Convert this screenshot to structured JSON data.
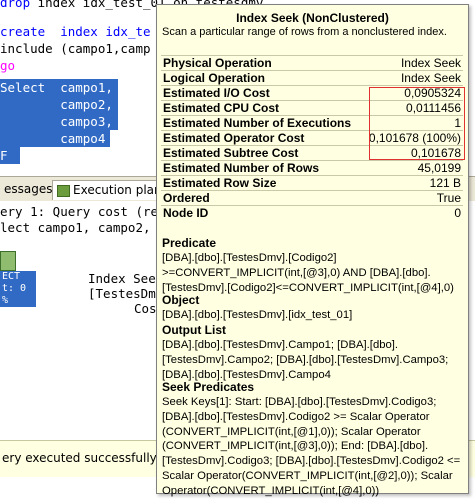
{
  "editor": {
    "lines": [
      {
        "kw": "drop",
        "rest": " index idx_test_01 on testesdmv"
      },
      {
        "kw": "create",
        "rest": "  index idx_te"
      },
      {
        "kw": "",
        "rest": "include (campo1,camp"
      },
      {
        "kw": "go",
        "rest": ""
      },
      {
        "kw": "Select",
        "rest": "  campo1,"
      },
      {
        "kw": "",
        "rest": "        campo2,"
      },
      {
        "kw": "",
        "rest": "        campo3,"
      },
      {
        "kw": "",
        "rest": "        campo4"
      },
      {
        "kw": "",
        "rest": "F"
      }
    ]
  },
  "tabs": {
    "messages": "essages",
    "execution_plan": "Execution plan"
  },
  "plan": {
    "query_header": "ery 1: Query cost (re",
    "query_text": "lect campo1, campo2,",
    "node_label_1": "ECT",
    "node_label_2": "t: 0 %",
    "op_line_1": "Index Seek",
    "op_line_2": "[TestesDm",
    "op_line_3": "Cost"
  },
  "status": {
    "message": "ery executed successfully."
  },
  "tooltip": {
    "title": "Index Seek (NonClustered)",
    "description": "Scan a particular range of rows from a nonclustered index.",
    "properties": [
      {
        "label": "Physical Operation",
        "value": "Index Seek"
      },
      {
        "label": "Logical Operation",
        "value": "Index Seek"
      },
      {
        "label": "Estimated I/O Cost",
        "value": "0,0905324"
      },
      {
        "label": "Estimated CPU Cost",
        "value": "0,0111456"
      },
      {
        "label": "Estimated Number of Executions",
        "value": "1"
      },
      {
        "label": "Estimated Operator Cost",
        "value": "0,101678 (100%)"
      },
      {
        "label": "Estimated Subtree Cost",
        "value": "0,101678"
      },
      {
        "label": "Estimated Number of Rows",
        "value": "45,0199"
      },
      {
        "label": "Estimated Row Size",
        "value": "121 B"
      },
      {
        "label": "Ordered",
        "value": "True"
      },
      {
        "label": "Node ID",
        "value": "0"
      }
    ],
    "predicate_title": "Predicate",
    "predicate": "[DBA].[dbo].[TestesDmv].[Codigo2] >=CONVERT_IMPLICIT(int,[@3],0) AND [DBA].[dbo].[TestesDmv].[Codigo2]<=CONVERT_IMPLICIT(int,[@4],0)",
    "object_title": "Object",
    "object": "[DBA].[dbo].[TestesDmv].[idx_test_01]",
    "output_title": "Output List",
    "output": "[DBA].[dbo].[TestesDmv].Campo1; [DBA].[dbo].[TestesDmv].Campo2; [DBA].[dbo].[TestesDmv].Campo3; [DBA].[dbo].[TestesDmv].Campo4",
    "seek_title": "Seek Predicates",
    "seek": "Seek Keys[1]: Start: [DBA].[dbo].[TestesDmv].Codigo3; [DBA].[dbo].[TestesDmv].Codigo2 >= Scalar Operator (CONVERT_IMPLICIT(int,[@1],0)); Scalar Operator (CONVERT_IMPLICIT(int,[@3],0)); End: [DBA].[dbo].[TestesDmv].Codigo3; [DBA].[dbo].[TestesDmv].Codigo2 <= Scalar Operator(CONVERT_IMPLICIT(int,[@2],0)); Scalar Operator(CONVERT_IMPLICIT(int,[@4],0))"
  },
  "colors": {
    "selection": "#316ac5",
    "keyword": "#0000ff",
    "tooltip_bg": "#ffffe1",
    "highlight_box": "#e03030"
  }
}
